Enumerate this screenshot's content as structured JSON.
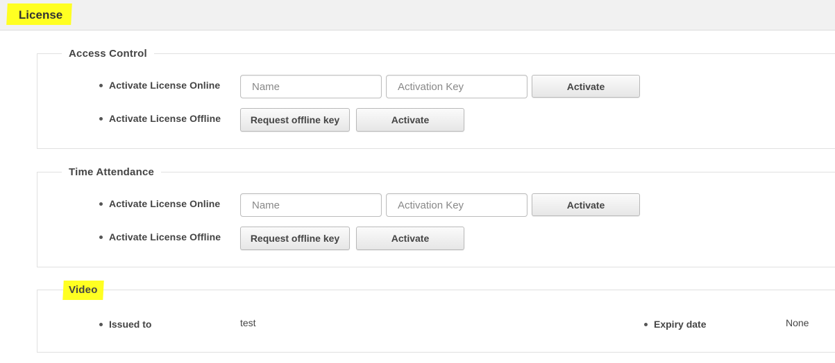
{
  "page": {
    "title": "License"
  },
  "sections": {
    "access_control": {
      "title": "Access Control",
      "online_label": "Activate License Online",
      "offline_label": "Activate License Offline",
      "name_placeholder": "Name",
      "key_placeholder": "Activation Key",
      "activate_label": "Activate",
      "request_offline_label": "Request offline key",
      "offline_activate_label": "Activate"
    },
    "time_attendance": {
      "title": "Time Attendance",
      "online_label": "Activate License Online",
      "offline_label": "Activate License Offline",
      "name_placeholder": "Name",
      "key_placeholder": "Activation Key",
      "activate_label": "Activate",
      "request_offline_label": "Request offline key",
      "offline_activate_label": "Activate"
    },
    "video": {
      "title": "Video",
      "issued_to_label": "Issued to",
      "issued_to_value": "test",
      "expiry_label": "Expiry date",
      "expiry_value": "None"
    }
  },
  "colors": {
    "highlight": "#ffff22",
    "header_bg": "#f1f1f1",
    "border": "#e0e0e0"
  }
}
